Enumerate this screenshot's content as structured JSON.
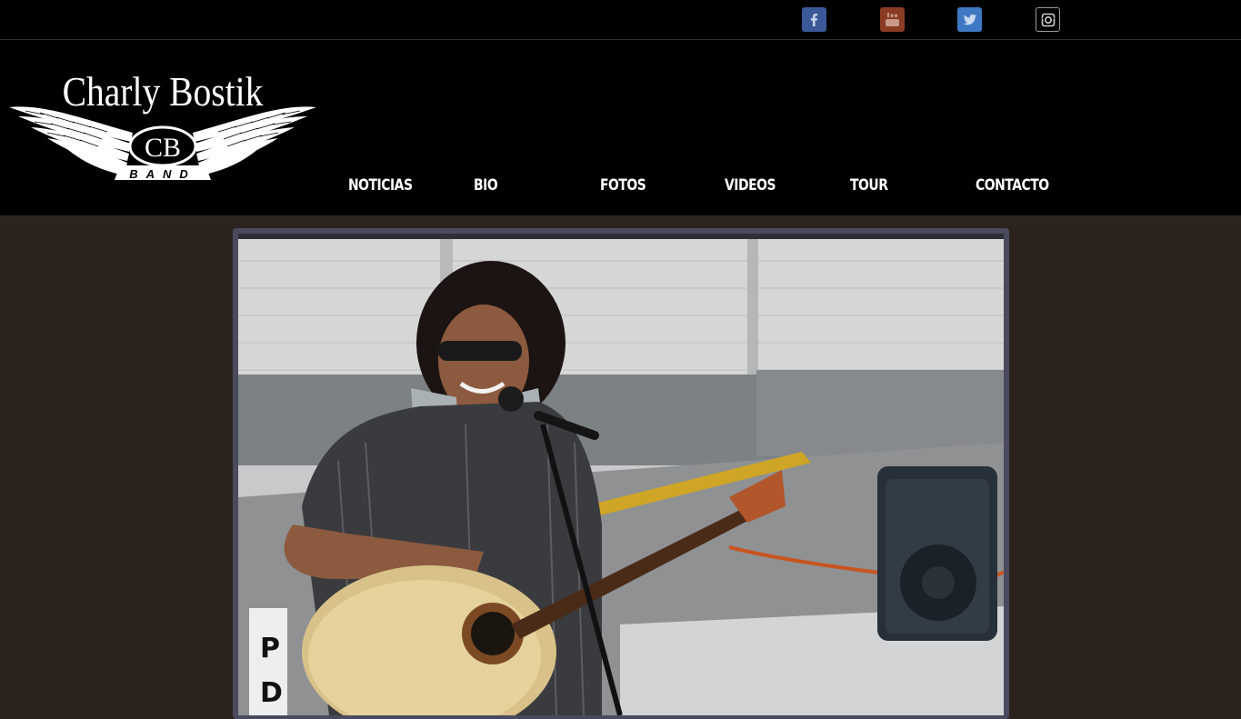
{
  "social": [
    {
      "name": "facebook",
      "icon": "facebook-icon",
      "color": "#3b5998"
    },
    {
      "name": "youtube",
      "icon": "youtube-icon",
      "color": "#8a3c22"
    },
    {
      "name": "twitter",
      "icon": "twitter-icon",
      "color": "#3f79c3"
    },
    {
      "name": "instagram",
      "icon": "instagram-icon",
      "color": "#000000"
    }
  ],
  "logo": {
    "title": "Charly Bostik",
    "monogram": "CB",
    "subtitle": "BAND"
  },
  "nav": {
    "items": [
      {
        "label": "NOTICIAS"
      },
      {
        "label": "BIO"
      },
      {
        "label": "FOTOS"
      },
      {
        "label": "VIDEOS"
      },
      {
        "label": "TOUR"
      },
      {
        "label": "CONTACTO"
      }
    ]
  },
  "colors": {
    "page_background": "#2c231f",
    "header_background": "#000000",
    "photo_frame": "#4a4a5e"
  }
}
